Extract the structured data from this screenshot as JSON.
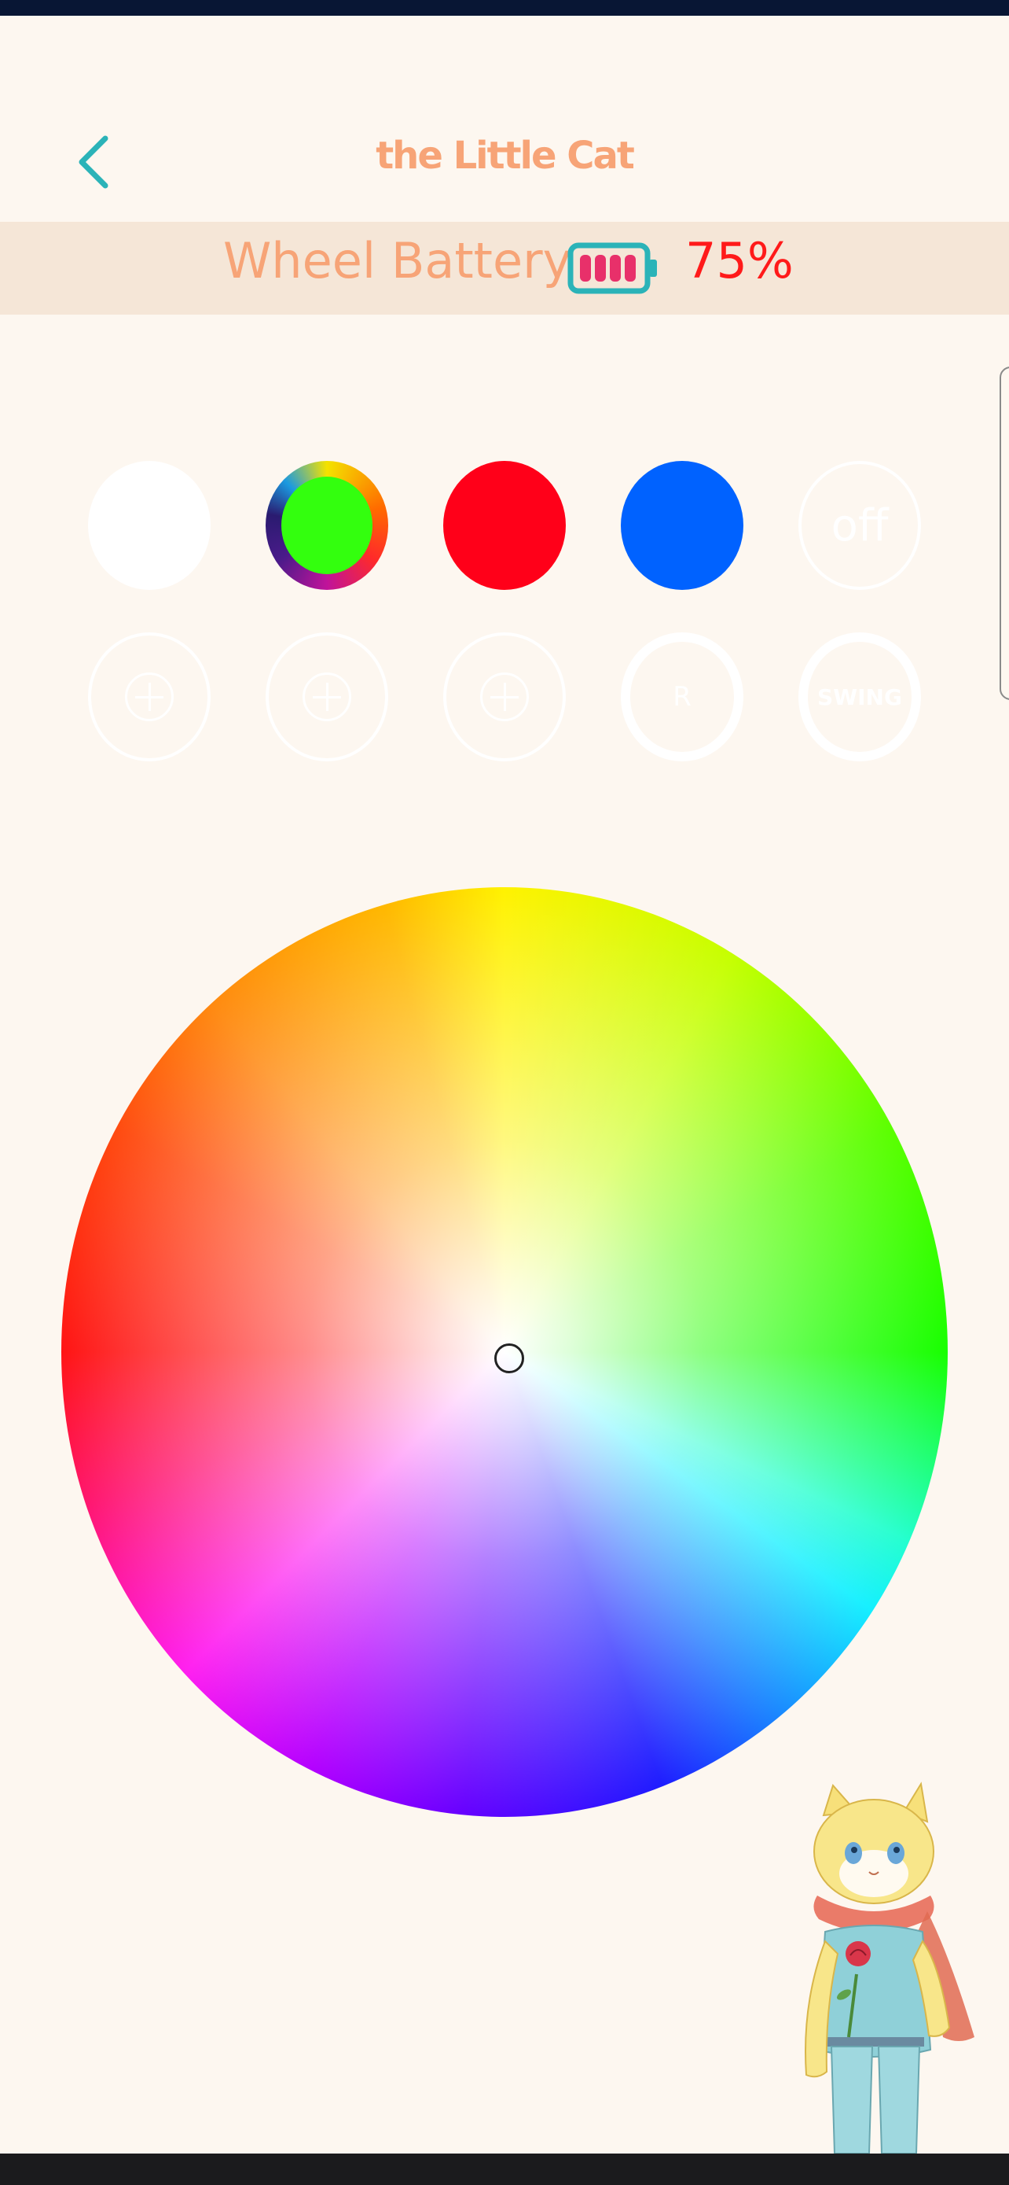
{
  "header": {
    "title": "the Little Cat",
    "back_icon": "chevron-left-icon"
  },
  "battery": {
    "label": "Wheel Battery",
    "percent_text": "75%",
    "level": 1.0,
    "icon": "battery-icon"
  },
  "color_presets": [
    {
      "name": "white",
      "color": "#ffffff"
    },
    {
      "name": "green",
      "color": "#33ff0e",
      "selected": true
    },
    {
      "name": "red",
      "color": "#ff0019"
    },
    {
      "name": "blue",
      "color": "#0062ff"
    }
  ],
  "off_button": {
    "label": "off"
  },
  "custom_slots": [
    {
      "icon": "add-icon"
    },
    {
      "icon": "add-icon"
    },
    {
      "icon": "add-icon"
    }
  ],
  "mode_buttons": {
    "rainbow_label": "R",
    "swing_label": "SWING"
  },
  "colors": {
    "background": "#fdf7f0",
    "accent": "#f7a477",
    "battery_band": "#f5e6d7",
    "percent": "#ff1a1a",
    "back_icon": "#2bb3b8"
  }
}
